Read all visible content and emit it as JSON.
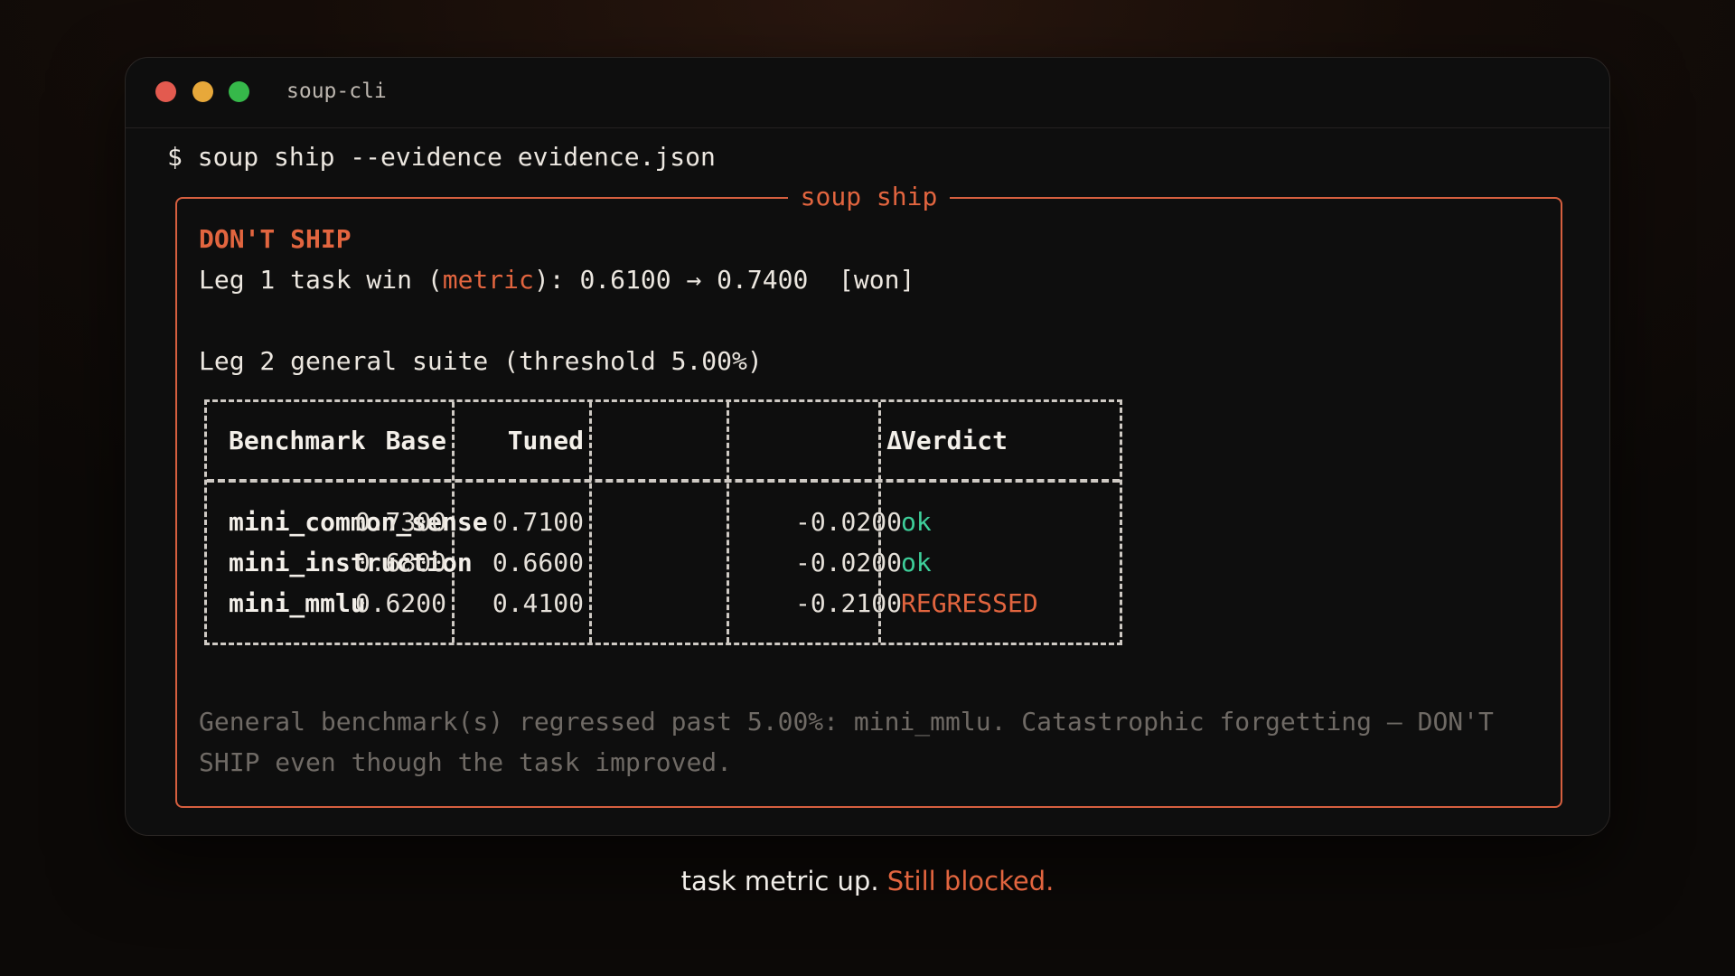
{
  "window": {
    "title": "soup-cli"
  },
  "terminal": {
    "prompt_symbol": "$",
    "command": "soup ship --evidence evidence.json"
  },
  "panel": {
    "title": "soup ship",
    "verdict": "DON'T SHIP",
    "leg1": {
      "prefix": "Leg 1 task win (",
      "metric": "metric",
      "suffix": "): 0.6100 → 0.7400  [won]"
    },
    "leg2": "Leg 2 general suite (threshold 5.00%)",
    "table": {
      "headers": {
        "benchmark": "Benchmark",
        "base": "Base",
        "tuned": "Tuned",
        "delta": "Δ",
        "verdict": "Verdict"
      },
      "rows": [
        {
          "benchmark": "mini_common_sense",
          "base": "0.7300",
          "tuned": "0.7100",
          "delta": "-0.0200",
          "verdict": "ok"
        },
        {
          "benchmark": "mini_instruction",
          "base": "0.6800",
          "tuned": "0.6600",
          "delta": "-0.0200",
          "verdict": "ok"
        },
        {
          "benchmark": "mini_mmlu",
          "base": "0.6200",
          "tuned": "0.4100",
          "delta": "-0.2100",
          "verdict": "REGRESSED"
        }
      ]
    },
    "note": "General benchmark(s) regressed past 5.00%: mini_mmlu. Catastrophic forgetting — DON'T SHIP even though the task improved."
  },
  "caption": {
    "text": "task metric up.",
    "accent": "Still blocked."
  },
  "colors": {
    "accent": "#e2653f",
    "ok": "#3ecf9a",
    "dim": "#6f6a65",
    "dot_close": "#e35a4f",
    "dot_minimize": "#e7a83a",
    "dot_maximize": "#36b84a"
  }
}
